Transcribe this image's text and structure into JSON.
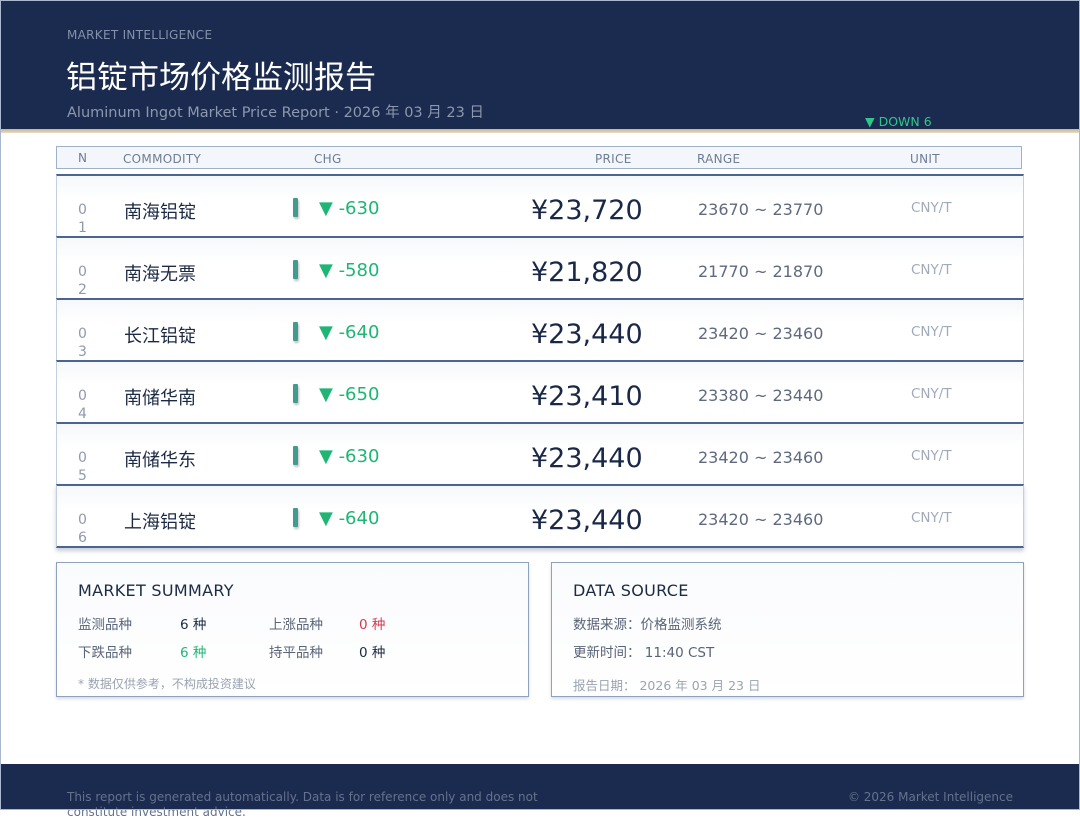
{
  "header": {
    "eyebrow": "MARKET INTELLIGENCE",
    "title": "铝锭市场价格监测报告",
    "subtitle": "Aluminum Ingot Market Price Report · 2026 年 03 月 23 日",
    "down_badge": "▼ DOWN 6"
  },
  "table": {
    "columns": {
      "no": "NO",
      "commodity": "COMMODITY",
      "chg": "CHG",
      "price": "PRICE",
      "range": "RANGE",
      "unit": "UNIT"
    },
    "rows": [
      {
        "no": "01",
        "name": "南海铝锭",
        "chg": "▼ -630",
        "price": "¥23,720",
        "range": "23670 ~ 23770",
        "unit": "CNY/T"
      },
      {
        "no": "02",
        "name": "南海无票",
        "chg": "▼ -580",
        "price": "¥21,820",
        "range": "21770 ~ 21870",
        "unit": "CNY/T"
      },
      {
        "no": "03",
        "name": "长江铝锭",
        "chg": "▼ -640",
        "price": "¥23,440",
        "range": "23420 ~ 23460",
        "unit": "CNY/T"
      },
      {
        "no": "04",
        "name": "南储华南",
        "chg": "▼ -650",
        "price": "¥23,410",
        "range": "23380 ~ 23440",
        "unit": "CNY/T"
      },
      {
        "no": "05",
        "name": "南储华东",
        "chg": "▼ -630",
        "price": "¥23,440",
        "range": "23420 ~ 23460",
        "unit": "CNY/T"
      },
      {
        "no": "06",
        "name": "上海铝锭",
        "chg": "▼ -640",
        "price": "¥23,440",
        "range": "23420 ~ 23460",
        "unit": "CNY/T"
      }
    ]
  },
  "summary": {
    "title": "MARKET SUMMARY",
    "monitored_label": "监测品种",
    "monitored_value": "6 种",
    "up_label": "上涨品种",
    "up_value": "0 种",
    "down_label": "下跌品种",
    "down_value": "6 种",
    "flat_label": "持平品种",
    "flat_value": "0 种",
    "note": "* 数据仅供参考，不构成投资建议"
  },
  "source": {
    "title": "DATA SOURCE",
    "line1": "数据来源：价格监测系统",
    "line2": "更新时间： 11:40 CST",
    "line3": "报告日期： 2026 年 03 月 23 日"
  },
  "footer": {
    "disclaimer": "This report is generated automatically. Data is for reference only and does not constitute investment advice.",
    "copyright": "© 2026 Market Intelligence"
  },
  "colors": {
    "navy": "#1b2b4f",
    "down_green": "#1fb675",
    "up_red": "#d63a48",
    "gold": "#c7b48d"
  }
}
